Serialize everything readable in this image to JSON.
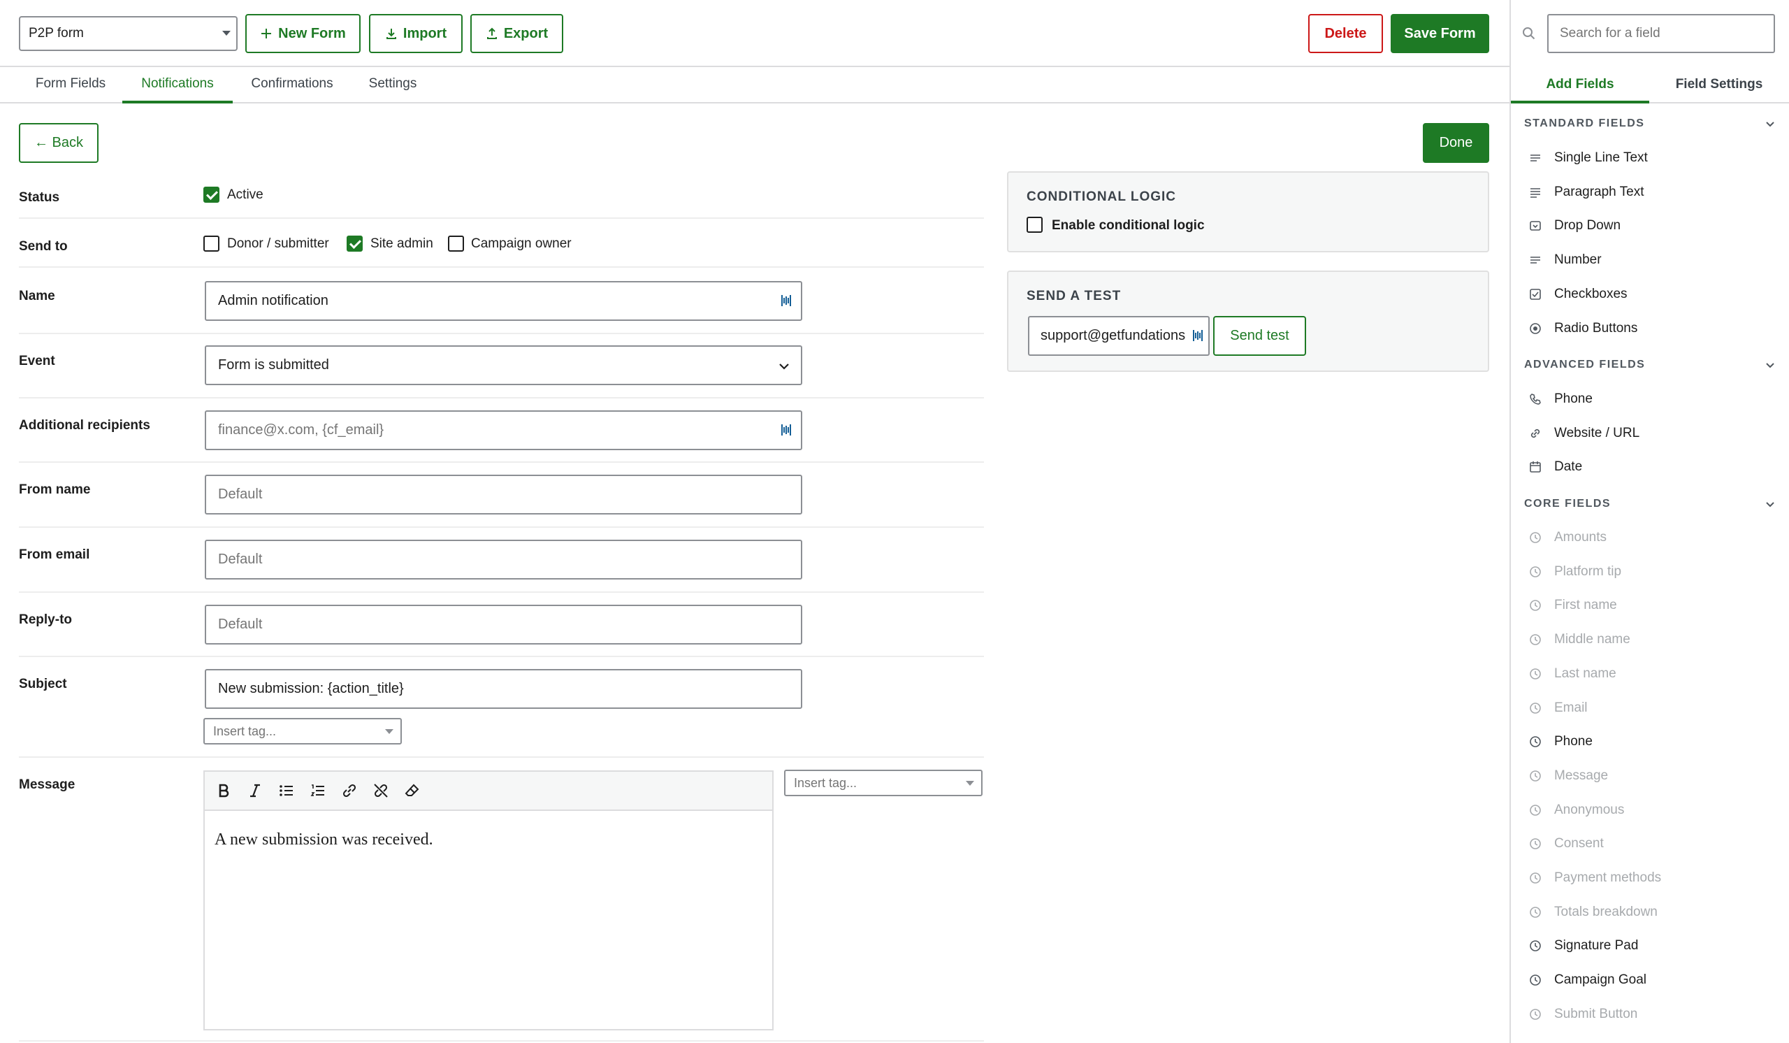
{
  "header": {
    "form_select_value": "P2P form",
    "new_form_label": "New Form",
    "import_label": "Import",
    "export_label": "Export",
    "delete_label": "Delete",
    "save_label": "Save Form"
  },
  "tabs": [
    {
      "label": "Form Fields"
    },
    {
      "label": "Notifications"
    },
    {
      "label": "Confirmations"
    },
    {
      "label": "Settings"
    }
  ],
  "active_tab": "Notifications",
  "back_label": "← Back",
  "done_label": "Done",
  "notification": {
    "status": {
      "label": "Status",
      "option": "Active",
      "checked": true
    },
    "send_to": {
      "label": "Send to",
      "options": [
        {
          "label": "Donor / submitter",
          "checked": false
        },
        {
          "label": "Site admin",
          "checked": true
        },
        {
          "label": "Campaign owner",
          "checked": false
        }
      ]
    },
    "name": {
      "label": "Name",
      "value": "Admin notification"
    },
    "event": {
      "label": "Event",
      "value": "Form is submitted"
    },
    "additional_recipients": {
      "label": "Additional recipients",
      "placeholder": "finance@x.com, {cf_email}"
    },
    "from_name": {
      "label": "From name",
      "placeholder": "Default"
    },
    "from_email": {
      "label": "From email",
      "placeholder": "Default"
    },
    "reply_to": {
      "label": "Reply-to",
      "placeholder": "Default"
    },
    "subject": {
      "label": "Subject",
      "value": "New submission: {action_title}",
      "insert_tag": "Insert tag..."
    },
    "message": {
      "label": "Message",
      "body": "A new submission was received.",
      "insert_tag": "Insert tag..."
    }
  },
  "editor_toolbar": [
    "bold-icon",
    "italic-icon",
    "bullet-list-icon",
    "numbered-list-icon",
    "link-icon",
    "unlink-icon",
    "eraser-icon"
  ],
  "conditional_logic": {
    "title": "CONDITIONAL LOGIC",
    "checkbox_label": "Enable conditional logic",
    "checked": false
  },
  "send_test": {
    "title": "SEND A TEST",
    "email_value": "support@getfundations",
    "button_label": "Send test"
  },
  "sidebar": {
    "search_placeholder": "Search for a field",
    "tabs": [
      {
        "label": "Add Fields"
      },
      {
        "label": "Field Settings"
      }
    ],
    "active_tab": "Add Fields",
    "sections": [
      {
        "title": "STANDARD FIELDS",
        "items": [
          {
            "label": "Single Line Text",
            "icon": "single-line-icon",
            "disabled": false
          },
          {
            "label": "Paragraph Text",
            "icon": "paragraph-icon",
            "disabled": false
          },
          {
            "label": "Drop Down",
            "icon": "dropdown-icon",
            "disabled": false
          },
          {
            "label": "Number",
            "icon": "number-icon",
            "disabled": false
          },
          {
            "label": "Checkboxes",
            "icon": "checkbox-icon",
            "disabled": false
          },
          {
            "label": "Radio Buttons",
            "icon": "radio-icon",
            "disabled": false
          }
        ]
      },
      {
        "title": "ADVANCED FIELDS",
        "items": [
          {
            "label": "Phone",
            "icon": "phone-icon",
            "disabled": false
          },
          {
            "label": "Website / URL",
            "icon": "link-icon",
            "disabled": false
          },
          {
            "label": "Date",
            "icon": "calendar-icon",
            "disabled": false
          }
        ]
      },
      {
        "title": "CORE FIELDS",
        "items": [
          {
            "label": "Amounts",
            "icon": "clock-icon",
            "disabled": true
          },
          {
            "label": "Platform tip",
            "icon": "clock-icon",
            "disabled": true
          },
          {
            "label": "First name",
            "icon": "clock-icon",
            "disabled": true
          },
          {
            "label": "Middle name",
            "icon": "clock-icon",
            "disabled": true
          },
          {
            "label": "Last name",
            "icon": "clock-icon",
            "disabled": true
          },
          {
            "label": "Email",
            "icon": "clock-icon",
            "disabled": true
          },
          {
            "label": "Phone",
            "icon": "clock-icon",
            "disabled": false
          },
          {
            "label": "Message",
            "icon": "clock-icon",
            "disabled": true
          },
          {
            "label": "Anonymous",
            "icon": "clock-icon",
            "disabled": true
          },
          {
            "label": "Consent",
            "icon": "clock-icon",
            "disabled": true
          },
          {
            "label": "Payment methods",
            "icon": "clock-icon",
            "disabled": true
          },
          {
            "label": "Totals breakdown",
            "icon": "clock-icon",
            "disabled": true
          },
          {
            "label": "Signature Pad",
            "icon": "clock-icon",
            "disabled": false
          },
          {
            "label": "Campaign Goal",
            "icon": "clock-icon",
            "disabled": false
          },
          {
            "label": "Submit Button",
            "icon": "clock-icon",
            "disabled": true
          }
        ]
      }
    ]
  },
  "colors": {
    "accent": "#1e7a25",
    "danger": "#cc1818",
    "border": "#8c8f94",
    "disabled_text": "#a7aaad"
  }
}
